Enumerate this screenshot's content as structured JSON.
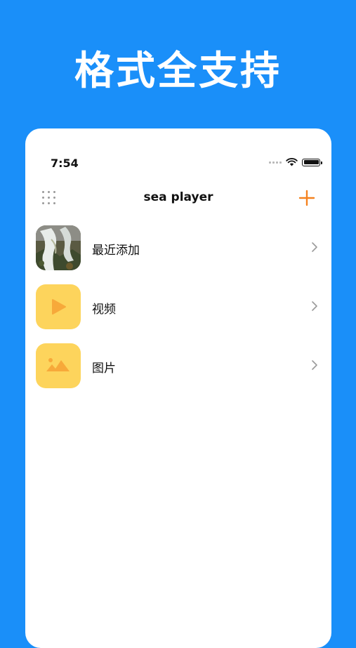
{
  "banner": {
    "headline": "格式全支持"
  },
  "status_bar": {
    "time": "7:54"
  },
  "navbar": {
    "title": "sea player"
  },
  "list": {
    "items": [
      {
        "label": "最近添加",
        "icon": "thumbnail-photo"
      },
      {
        "label": "视频",
        "icon": "play-icon"
      },
      {
        "label": "图片",
        "icon": "image-icon"
      }
    ]
  },
  "colors": {
    "background": "#1a8ff9",
    "accent": "#f5821f",
    "folder_yellow": "#fdd45c",
    "folder_icon": "#f7a93a"
  }
}
